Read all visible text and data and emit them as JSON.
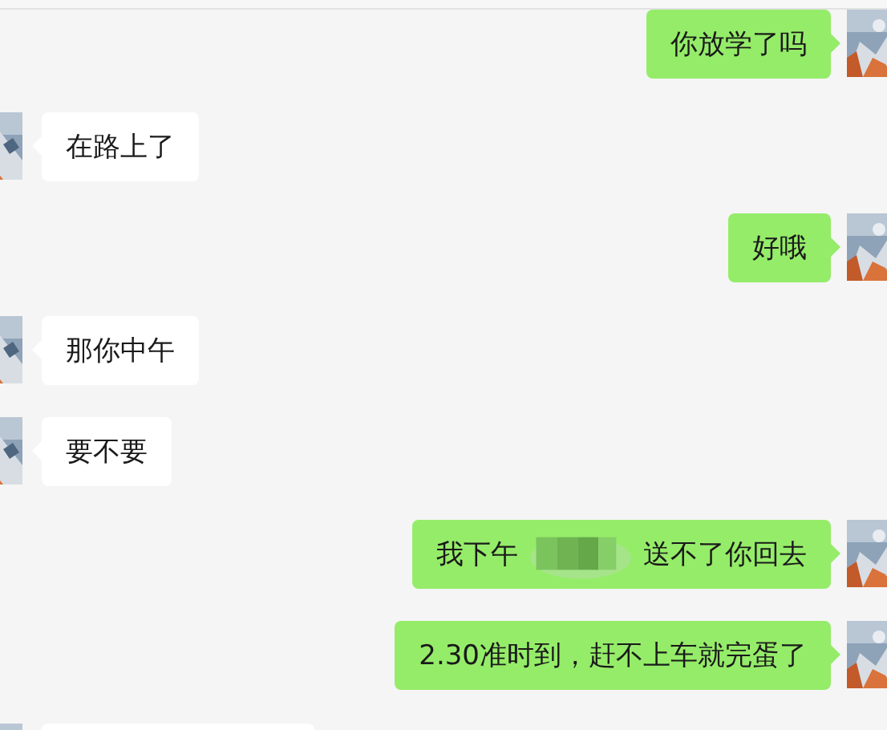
{
  "messages": [
    {
      "kind": "sent",
      "text": "你放学了吗"
    },
    {
      "kind": "received",
      "text": "在路上了"
    },
    {
      "kind": "sent",
      "text": "好哦"
    },
    {
      "kind": "received",
      "text": "那你中午"
    },
    {
      "kind": "received",
      "text": "要不要"
    },
    {
      "kind": "sent_redacted",
      "parts": [
        "我下午",
        "送不了你回去"
      ]
    },
    {
      "kind": "sent",
      "text": "2.30准时到，赶不上车就完蛋了"
    },
    {
      "kind": "received_cut"
    }
  ]
}
